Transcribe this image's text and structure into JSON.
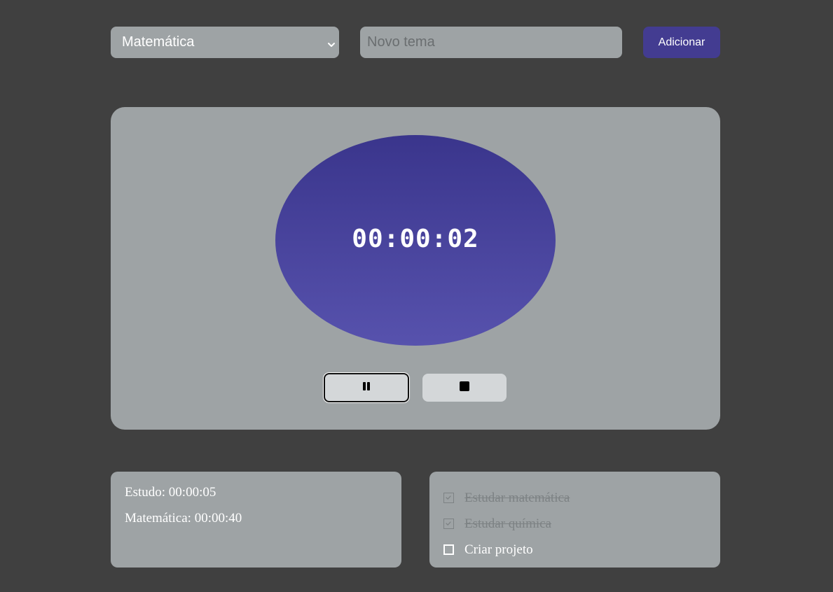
{
  "topbar": {
    "subject_select": {
      "selected": "Matemática",
      "icon": "chevron-down-icon"
    },
    "new_topic_input": {
      "value": "",
      "placeholder": "Novo tema"
    },
    "add_button_label": "Adicionar"
  },
  "timer": {
    "display": "00:00:02",
    "pause_icon": "pause-icon",
    "stop_icon": "stop-icon"
  },
  "stats": [
    {
      "text": "Estudo: 00:00:05"
    },
    {
      "text": "Matemática: 00:00:40"
    }
  ],
  "tasks": [
    {
      "label": "Estudar matemática",
      "done": true
    },
    {
      "label": "Estudar química",
      "done": true
    },
    {
      "label": "Criar projeto",
      "done": false
    }
  ],
  "colors": {
    "background": "#404040",
    "panel": "#9ea3a5",
    "accent": "#433c91",
    "timer_gradient_top": "#3a358c",
    "timer_gradient_bottom": "#5752ad",
    "control_button": "#d4d7d9",
    "done_text": "#7d8284"
  }
}
